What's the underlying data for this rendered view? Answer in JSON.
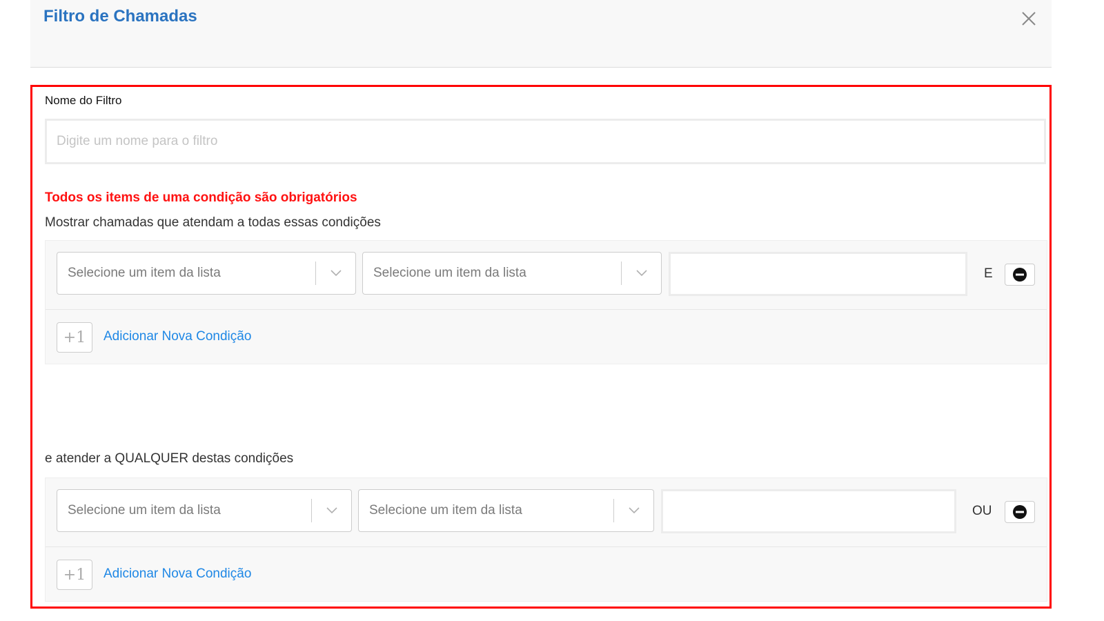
{
  "modal": {
    "title": "Filtro de Chamadas",
    "close_icon": "close-icon"
  },
  "form": {
    "name_label": "Nome do Filtro",
    "name_placeholder": "Digite um nome para o filtro",
    "name_value": "",
    "required_warning": "Todos os items de uma condição são obrigatórios",
    "highlight_color": "#ff0000",
    "accent_color": "#2a73c0",
    "link_color": "#1e87e5"
  },
  "all_conditions": {
    "description": "Mostrar chamadas que atendam a todas essas condições",
    "rows": [
      {
        "field_placeholder": "Selecione um item da lista",
        "operator_placeholder": "Selecione um item da lista",
        "value": "",
        "logic": "E"
      }
    ],
    "add_icon_text": "+1",
    "add_label": "Adicionar Nova Condição"
  },
  "any_conditions": {
    "description": "e atender a QUALQUER destas condições",
    "rows": [
      {
        "field_placeholder": "Selecione um item da lista",
        "operator_placeholder": "Selecione um item da lista",
        "value": "",
        "logic": "OU"
      }
    ],
    "add_icon_text": "+1",
    "add_label": "Adicionar Nova Condição"
  }
}
